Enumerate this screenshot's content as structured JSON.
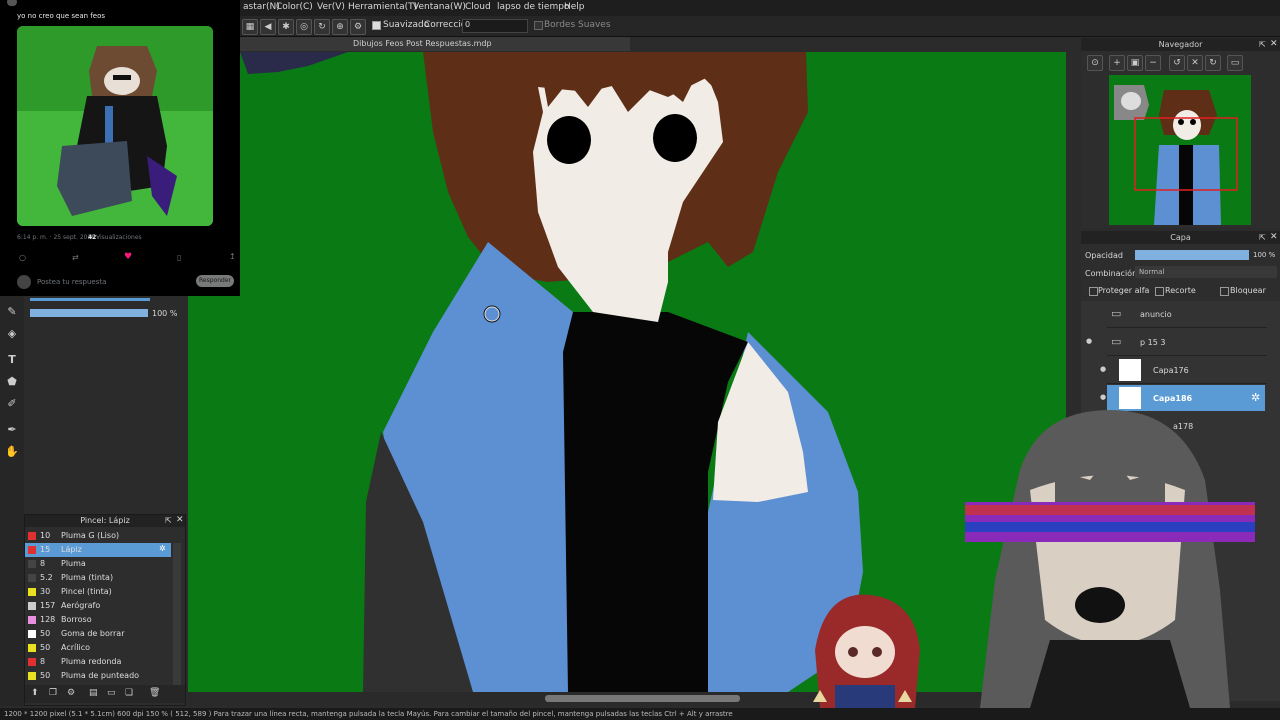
{
  "menu": [
    "astar(N)",
    "Color(C)",
    "Ver(V)",
    "Herramienta(T)",
    "Ventana(W)",
    "Cloud",
    "lapso de tiempo",
    "Help"
  ],
  "toolbar": {
    "smoothing_label": "Suavizado",
    "correction_label": "Corrección",
    "correction_value": "0",
    "soft_edges_label": "Bordes Suaves"
  },
  "document_tab": "Dibujos Feos Post Respuestas.mdp",
  "tweet": {
    "text": "yo no creo que sean feos",
    "meta_time": "6:14 p. m. · 25 sept. 2026 ·",
    "meta_views_count": "42",
    "meta_views_label": "Visualizaciones",
    "reply_placeholder": "Postea tu respuesta",
    "reply_button": "Responder"
  },
  "brush_settings": {
    "opacity_value": "100 %"
  },
  "brush_panel": {
    "title": "Pincel: Lápiz",
    "items": [
      {
        "size": "10",
        "name": "Pluma G (Liso)",
        "color": "#e03030"
      },
      {
        "size": "15",
        "name": "Lápiz",
        "color": "#e03030",
        "selected": true
      },
      {
        "size": "8",
        "name": "Pluma",
        "color": "#444444"
      },
      {
        "size": "5.2",
        "name": "Pluma (tinta)",
        "color": "#444444"
      },
      {
        "size": "30",
        "name": "Pincel (tinta)",
        "color": "#e8e020"
      },
      {
        "size": "157",
        "name": "Aerógrafo",
        "color": "#cccccc"
      },
      {
        "size": "128",
        "name": "Borroso",
        "color": "#e890e0"
      },
      {
        "size": "50",
        "name": "Goma de borrar",
        "color": "#ffffff"
      },
      {
        "size": "50",
        "name": "Acrílico",
        "color": "#e8e020"
      },
      {
        "size": "8",
        "name": "Pluma redonda",
        "color": "#e03030"
      },
      {
        "size": "50",
        "name": "Pluma de punteado",
        "color": "#e8e020"
      }
    ]
  },
  "navigator": {
    "title": "Navegador"
  },
  "layer_panel": {
    "title": "Capa",
    "opacity_label": "Opacidad",
    "opacity_value": "100 %",
    "blend_label": "Combinación",
    "blend_value": "Normal",
    "protect_alpha": "Proteger alfa",
    "clip": "Recorte",
    "lock": "Bloquear",
    "layers": [
      {
        "name": "anuncio",
        "type": "folder"
      },
      {
        "name": "p 15 3",
        "type": "folder"
      },
      {
        "name": "Capa176",
        "type": "layer"
      },
      {
        "name": "Capa186",
        "type": "layer",
        "selected": true
      },
      {
        "name": "a178",
        "type": "layer"
      }
    ]
  },
  "status_bar": "1200 * 1200 pixel  (5.1 * 5.1cm)  600 dpi  150 %  ( 512, 589 )  Para trazar una línea recta, mantenga pulsada la tecla Mayús. Para cambiar el tamaño del pincel, mantenga pulsadas las teclas Ctrl + Alt y arrastre",
  "colors": {
    "canvas_green": "#0a7a14",
    "hair_brown": "#5e2e17",
    "hoodie_blue": "#5d8fd3",
    "skin": "#f1ece6",
    "shirt_black": "#060606",
    "selected_blue": "#5b9bd5"
  }
}
